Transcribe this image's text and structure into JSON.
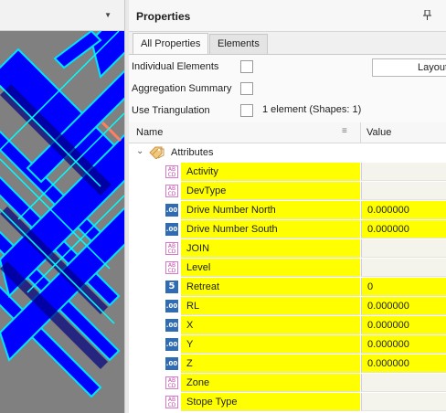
{
  "viewport": {
    "dropdown_icon": "triangle-down"
  },
  "panel": {
    "title": "Properties",
    "pin_icon": "pin",
    "tabs": [
      {
        "label": "All Properties",
        "active": true
      },
      {
        "label": "Elements",
        "active": false
      }
    ],
    "options": {
      "individual_elements": "Individual Elements",
      "aggregation_summary": "Aggregation Summary",
      "use_triangulation": "Use Triangulation",
      "layout_button": "Layout",
      "element_count": "1 element (Shapes: 1)"
    },
    "grid": {
      "col_name": "Name",
      "col_value": "Value",
      "category": "Attributes",
      "rows": [
        {
          "name": "Activity",
          "type": "text",
          "value": ""
        },
        {
          "name": "DevType",
          "type": "text",
          "value": ""
        },
        {
          "name": "Drive Number North",
          "type": "num",
          "value": "0.000000"
        },
        {
          "name": "Drive Number South",
          "type": "num",
          "value": "0.000000"
        },
        {
          "name": "JOIN",
          "type": "text",
          "value": ""
        },
        {
          "name": "Level",
          "type": "text",
          "value": ""
        },
        {
          "name": "Retreat",
          "type": "int",
          "value": "0"
        },
        {
          "name": "RL",
          "type": "num",
          "value": "0.000000"
        },
        {
          "name": "X",
          "type": "num",
          "value": "0.000000"
        },
        {
          "name": "Y",
          "type": "num",
          "value": "0.000000"
        },
        {
          "name": "Z",
          "type": "num",
          "value": "0.000000"
        },
        {
          "name": "Zone",
          "type": "text",
          "value": ""
        },
        {
          "name": "Stope Type",
          "type": "text",
          "value": ""
        }
      ]
    }
  },
  "colors": {
    "highlight": "#ffff00",
    "viewport_bg": "#808080",
    "drive_fill": "#0000ff",
    "drive_outline": "#00ffff",
    "selected_segment": "#ff8060"
  }
}
